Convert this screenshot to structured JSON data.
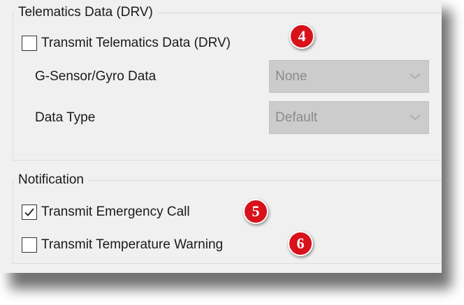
{
  "telematics": {
    "legend": "Telematics Data (DRV)",
    "transmit_checkbox": {
      "label": "Transmit Telematics Data (DRV)",
      "checked": false
    },
    "gsensor": {
      "label": "G-Sensor/Gyro Data",
      "value": "None"
    },
    "data_type": {
      "label": "Data Type",
      "value": "Default"
    }
  },
  "notification": {
    "legend": "Notification",
    "emergency_call": {
      "label": "Transmit Emergency Call",
      "checked": true
    },
    "temperature_warning": {
      "label": "Transmit Temperature Warning",
      "checked": false
    }
  },
  "callouts": {
    "four": "4",
    "five": "5",
    "six": "6"
  },
  "colors": {
    "panel_bg": "#f0f0f0",
    "disabled_select_bg": "#cccccc",
    "callout_red": "#d8121b"
  },
  "icons": {
    "checkmark": "checkmark-icon",
    "chevron": "chevron-down-icon"
  }
}
